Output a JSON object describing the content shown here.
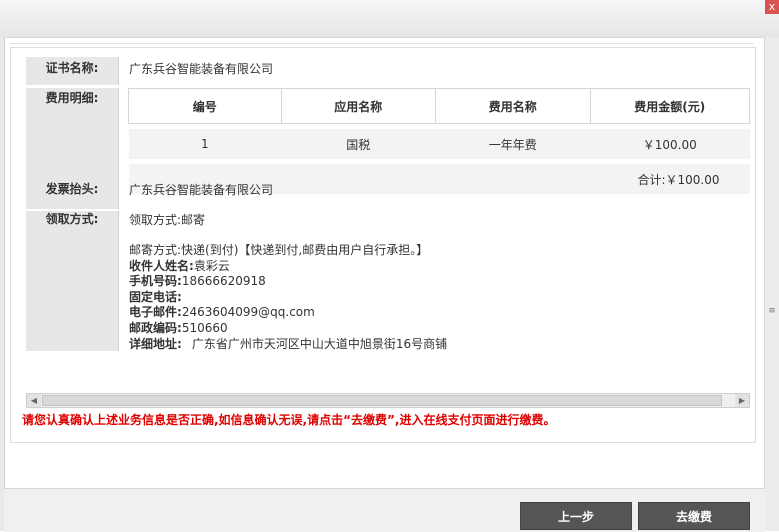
{
  "window": {
    "close_glyph": "x"
  },
  "certificate": {
    "label": "证书名称:",
    "value": "广东兵谷智能装备有限公司"
  },
  "fee_detail": {
    "label": "费用明细:",
    "headers": [
      "编号",
      "应用名称",
      "费用名称",
      "费用金额(元)"
    ],
    "rows": [
      {
        "no": "1",
        "app": "国税",
        "fee": "一年年费",
        "amount": "￥100.00"
      }
    ],
    "total": "合计:￥100.00"
  },
  "invoice": {
    "label": "发票抬头:",
    "value": "广东兵谷智能装备有限公司"
  },
  "pickup": {
    "label": "领取方式:",
    "method_line": "领取方式:邮寄",
    "mail_line": "邮寄方式:快递(到付)【快递到付,邮费由用户自行承担。】",
    "recipient": {
      "label": "收件人姓名:",
      "value": "袁彩云"
    },
    "phone": {
      "label": "手机号码:",
      "value": "18666620918"
    },
    "landline": {
      "label": "固定电话:",
      "value": ""
    },
    "email": {
      "label": "电子邮件:",
      "value": "2463604099@qq.com"
    },
    "postcode": {
      "label": "邮政编码:",
      "value": "510660"
    },
    "address": {
      "label": "详细地址:",
      "value": "广东省广州市天河区中山大道中旭景街16号商铺"
    }
  },
  "notice": "请您认真确认上述业务信息是否正确,如信息确认无误,请点击“去缴费”,进入在线支付页面进行缴费。",
  "buttons": {
    "prev": "上一步",
    "pay": "去缴费"
  },
  "icons": {
    "close": "close-icon",
    "left_arrow": "scroll-left-icon",
    "right_arrow": "scroll-right-icon"
  }
}
